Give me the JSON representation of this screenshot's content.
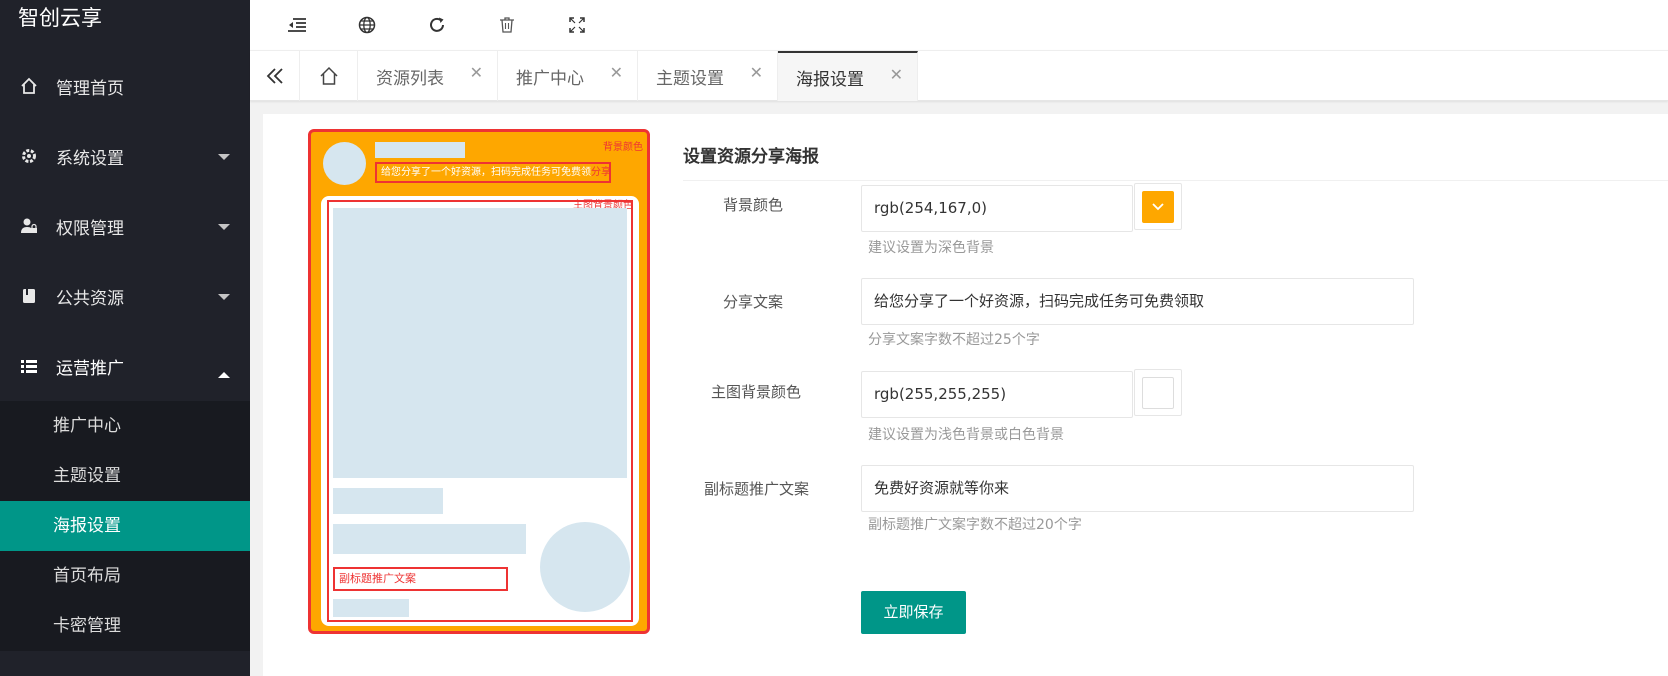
{
  "app": {
    "title": "智创云享"
  },
  "sidebar": {
    "items": [
      {
        "label": "管理首页",
        "icon": "home-icon"
      },
      {
        "label": "系统设置",
        "icon": "gear-icon"
      },
      {
        "label": "权限管理",
        "icon": "user-lock-icon"
      },
      {
        "label": "公共资源",
        "icon": "book-icon"
      },
      {
        "label": "运营推广",
        "icon": "list-icon"
      }
    ],
    "submenu": [
      {
        "label": "推广中心"
      },
      {
        "label": "主题设置"
      },
      {
        "label": "海报设置",
        "active": true
      },
      {
        "label": "首页布局"
      },
      {
        "label": "卡密管理"
      }
    ]
  },
  "toolbar": {
    "icons": [
      "outdent-icon",
      "globe-icon",
      "refresh-icon",
      "trash-icon",
      "fullscreen-icon"
    ]
  },
  "tabs": {
    "items": [
      {
        "label": "资源列表"
      },
      {
        "label": "推广中心"
      },
      {
        "label": "主题设置"
      },
      {
        "label": "海报设置",
        "active": true
      }
    ]
  },
  "poster": {
    "share_text": "给您分享了一个好资源，扫码完成任务可免费领",
    "share_tag": "分享文案",
    "bg_color_label": "背景颜色",
    "main_bg_label": "主图背景颜色",
    "subtitle_label": "副标题推广文案"
  },
  "form": {
    "title": "设置资源分享海报",
    "bg_color": {
      "label": "背景颜色",
      "value": "rgb(254,167,0)",
      "hint": "建议设置为深色背景",
      "swatch": "#fea700"
    },
    "share_text": {
      "label": "分享文案",
      "value": "给您分享了一个好资源，扫码完成任务可免费领取",
      "hint": "分享文案字数不超过25个字"
    },
    "main_bg_color": {
      "label": "主图背景颜色",
      "value": "rgb(255,255,255)",
      "hint": "建议设置为浅色背景或白色背景",
      "swatch": "#ffffff"
    },
    "subtitle": {
      "label": "副标题推广文案",
      "value": "免费好资源就等你来",
      "hint": "副标题推广文案字数不超过20个字"
    },
    "save_label": "立即保存"
  },
  "colors": {
    "accent": "#009688",
    "sidebar_bg": "#20222a",
    "poster_bg": "#fea700",
    "highlight": "#e33333"
  }
}
